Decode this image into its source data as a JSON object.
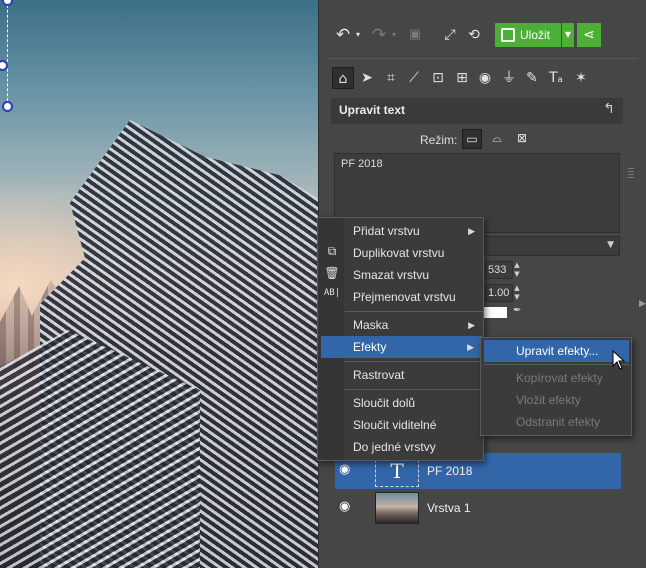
{
  "toolbar": {
    "undo_icon": "undo-icon",
    "redo_icon": "redo-icon",
    "save_label": "Uložit"
  },
  "tools": [
    "home-icon",
    "pointer-icon",
    "crop-icon",
    "straighten-icon",
    "transform-icon",
    "text-frame-icon",
    "eye-icon",
    "filter-icon",
    "brush-icon",
    "text-tool-icon",
    "sparkle-icon"
  ],
  "section": {
    "title": "Upravit text",
    "mode_label": "Režim:"
  },
  "editor": {
    "text_value": "PF 2018",
    "size_value": "533",
    "scale_value": "1.00",
    "text_color": "#ffffff"
  },
  "context_menu": {
    "items": [
      {
        "label": "Přidat vrstvu",
        "has_sub": true
      },
      {
        "label": "Duplikovat vrstvu",
        "has_sub": false
      },
      {
        "label": "Smazat vrstvu",
        "has_sub": false
      },
      {
        "label": "Přejmenovat vrstvu",
        "has_sub": false
      },
      {
        "label": "Maska",
        "has_sub": true
      },
      {
        "label": "Efekty",
        "has_sub": true
      },
      {
        "label": "Rastrovat",
        "has_sub": false
      },
      {
        "label": "Sloučit dolů",
        "has_sub": false
      },
      {
        "label": "Sloučit viditelné",
        "has_sub": false
      },
      {
        "label": "Do jedné vrstvy",
        "has_sub": false
      }
    ]
  },
  "effects_submenu": {
    "items": [
      {
        "label": "Upravit efekty...",
        "enabled": true
      },
      {
        "label": "Kopírovat efekty",
        "enabled": false
      },
      {
        "label": "Vložit efekty",
        "enabled": false
      },
      {
        "label": "Odstranit efekty",
        "enabled": false
      }
    ]
  },
  "layers": [
    {
      "name": "PF 2018",
      "selected": true,
      "thumb": "T"
    },
    {
      "name": "Vrstva 1",
      "selected": false
    }
  ],
  "colors": {
    "accent_green": "#4caf36",
    "selection_blue": "#3266a8"
  }
}
